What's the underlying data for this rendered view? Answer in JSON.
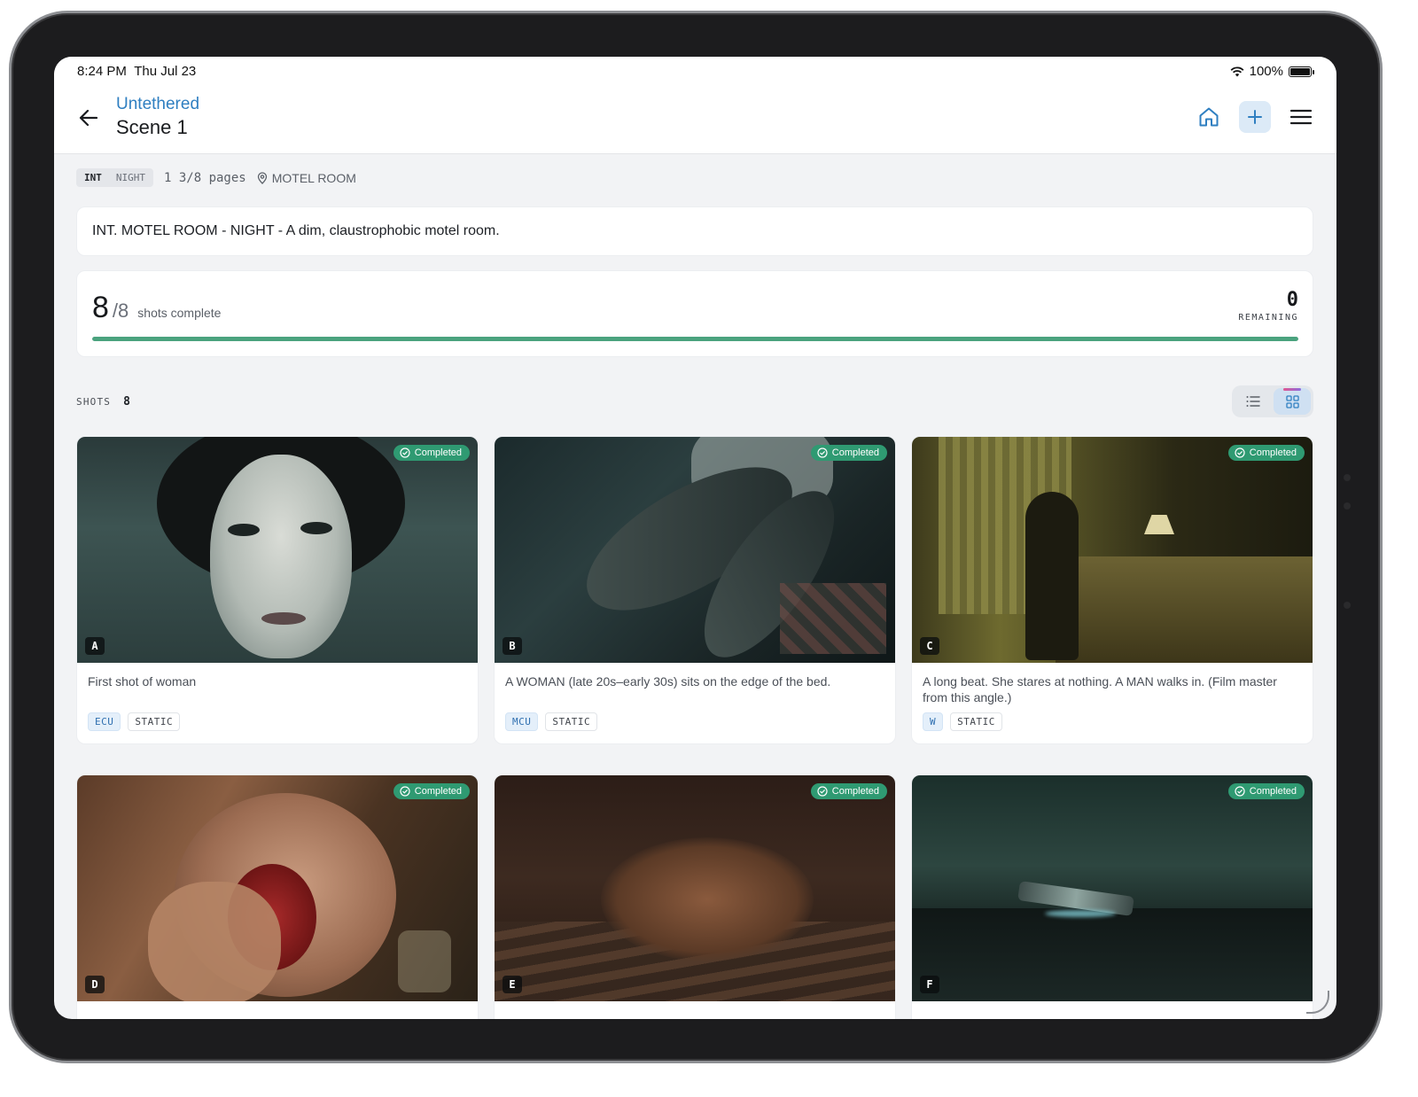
{
  "status_bar": {
    "time": "8:24 PM",
    "date": "Thu Jul 23",
    "battery": "100%"
  },
  "nav": {
    "project": "Untethered",
    "scene": "Scene 1"
  },
  "meta": {
    "int_ext": "INT",
    "time_of_day": "NIGHT",
    "pages": "1 3/8 pages",
    "location": "MOTEL ROOM"
  },
  "heading": "INT. MOTEL ROOM - NIGHT - A dim, claustrophobic motel room.",
  "progress": {
    "completed": "8",
    "total": "/8",
    "label": "shots complete",
    "remaining_value": "0",
    "remaining_label": "REMAINING",
    "fraction": 1.0
  },
  "shots_header": {
    "label": "SHOTS",
    "count": "8"
  },
  "colors": {
    "accent": "#2f7fc1",
    "completed": "#2f9a72",
    "progress": "#4aa37e"
  },
  "shots": [
    {
      "letter": "A",
      "status": "Completed",
      "description": "First shot of woman",
      "size": "ECU",
      "movement": "STATIC"
    },
    {
      "letter": "B",
      "status": "Completed",
      "description": "A WOMAN (late 20s–early 30s) sits on the edge of the bed.",
      "size": "MCU",
      "movement": "STATIC"
    },
    {
      "letter": "C",
      "status": "Completed",
      "description": "A long beat. She stares at nothing. A MAN walks in. (Film master from this angle.)",
      "size": "W",
      "movement": "STATIC"
    },
    {
      "letter": "D",
      "status": "Completed",
      "description": "",
      "size": "",
      "movement": ""
    },
    {
      "letter": "E",
      "status": "Completed",
      "description": "",
      "size": "",
      "movement": ""
    },
    {
      "letter": "F",
      "status": "Completed",
      "description": "",
      "size": "",
      "movement": ""
    }
  ]
}
